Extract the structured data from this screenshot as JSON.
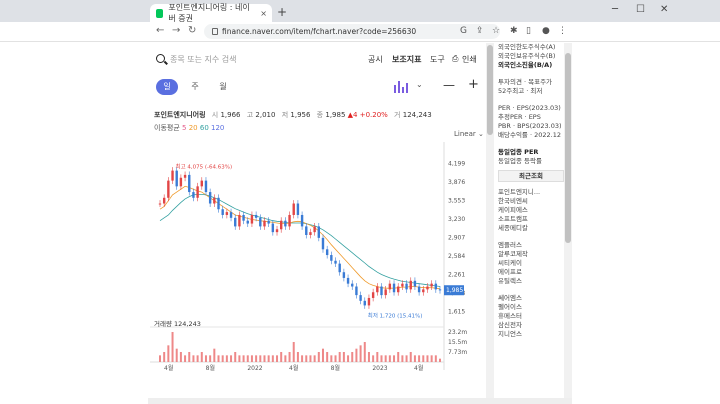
{
  "browser": {
    "tab_title": "포인트엔지니어링 : 네이버 증권",
    "tab_close": "×",
    "new_tab": "+",
    "url": "finance.naver.com/item/fchart.naver?code=256630",
    "win_min": "─",
    "win_max": "☐",
    "win_close": "✕"
  },
  "toolbar": {
    "search_placeholder": "종목 또는 지수 검색",
    "menu": [
      "공시",
      "보조지표",
      "도구",
      "인쇄"
    ]
  },
  "periods": [
    "일",
    "주",
    "월"
  ],
  "stock": {
    "name": "포인트엔지니어링",
    "open_label": "시",
    "open": "1,966",
    "high_label": "고",
    "high": "2,010",
    "low_label": "저",
    "low": "1,956",
    "close_label": "종",
    "close": "1,985",
    "change": "▲4 +0.20%",
    "volume_label": "거",
    "volume": "124,243"
  },
  "ma": {
    "label": "이동평균",
    "m5": "5",
    "m20": "20",
    "m60": "60",
    "m120": "120"
  },
  "scale_label": "Linear",
  "chart_data": {
    "type": "line",
    "x_ticks": [
      "4월",
      "8월",
      "2022",
      "4월",
      "8월",
      "2023",
      "4월"
    ],
    "y_ticks": [
      "4,199",
      "3,876",
      "3,553",
      "3,230",
      "2,907",
      "2,584",
      "2,261",
      "1,938",
      "1,615"
    ],
    "ylim": [
      1500,
      4400
    ],
    "current_price": "1,985",
    "max_label": "최고 4,075 (-64.63%)",
    "min_label": "최저 1,720 (15.41%)",
    "volume_label": "거래량 124,243",
    "volume_ticks": [
      "23.2m",
      "15.5m",
      "7.73m"
    ],
    "close": [
      3500,
      3600,
      3900,
      4075,
      3800,
      3950,
      4000,
      3700,
      3600,
      3800,
      3900,
      3700,
      3500,
      3600,
      3400,
      3300,
      3350,
      3250,
      3100,
      3300,
      3200,
      3150,
      3300,
      3250,
      3100,
      3200,
      3150,
      3000,
      3050,
      3200,
      3100,
      3300,
      3500,
      3300,
      3100,
      2950,
      3000,
      3100,
      2900,
      2700,
      2600,
      2500,
      2450,
      2300,
      2200,
      2100,
      2050,
      1900,
      1800,
      1720,
      1850,
      1950,
      2050,
      1900,
      2000,
      2100,
      1950,
      2050,
      2100,
      2000,
      2150,
      2050,
      1950,
      2000,
      2050,
      2100,
      2000,
      1985
    ],
    "ma20": [
      3400,
      3450,
      3550,
      3650,
      3700,
      3750,
      3800,
      3780,
      3750,
      3720,
      3700,
      3650,
      3600,
      3550,
      3500,
      3450,
      3400,
      3350,
      3300,
      3280,
      3260,
      3240,
      3220,
      3210,
      3200,
      3190,
      3180,
      3170,
      3160,
      3150,
      3150,
      3160,
      3180,
      3190,
      3180,
      3150,
      3120,
      3080,
      3020,
      2950,
      2870,
      2780,
      2700,
      2620,
      2540,
      2460,
      2380,
      2300,
      2220,
      2150,
      2100,
      2070,
      2050,
      2030,
      2020,
      2020,
      2020,
      2030,
      2040,
      2040,
      2050,
      2050,
      2040,
      2030,
      2030,
      2030,
      2020,
      2010
    ],
    "ma60": [
      3200,
      3250,
      3300,
      3380,
      3450,
      3520,
      3580,
      3620,
      3650,
      3660,
      3660,
      3650,
      3630,
      3600,
      3570,
      3530,
      3490,
      3450,
      3410,
      3380,
      3350,
      3320,
      3300,
      3280,
      3260,
      3240,
      3220,
      3200,
      3190,
      3180,
      3170,
      3160,
      3160,
      3160,
      3160,
      3150,
      3130,
      3110,
      3080,
      3040,
      2990,
      2940,
      2880,
      2820,
      2760,
      2700,
      2640,
      2580,
      2520,
      2460,
      2400,
      2350,
      2300,
      2260,
      2230,
      2200,
      2180,
      2160,
      2140,
      2130,
      2120,
      2110,
      2100,
      2090,
      2080,
      2070,
      2060,
      2050
    ],
    "volume": [
      2,
      3,
      5,
      9,
      4,
      3,
      2,
      3,
      2,
      2,
      3,
      2,
      2,
      4,
      2,
      2,
      2,
      2,
      3,
      2,
      2,
      2,
      2,
      2,
      2,
      2,
      2,
      2,
      2,
      3,
      2,
      3,
      6,
      3,
      2,
      2,
      2,
      2,
      3,
      4,
      3,
      2,
      2,
      3,
      3,
      2,
      3,
      4,
      5,
      6,
      3,
      2,
      3,
      2,
      2,
      2,
      2,
      3,
      2,
      2,
      3,
      2,
      2,
      2,
      2,
      2,
      2,
      1
    ]
  },
  "sidebar": {
    "items_top": [
      "외국인한도주식수(A)",
      "외국인보유주식수(B)",
      "외국인소진율(B/A)"
    ],
    "items_mid": [
      "투자의견 · 목표주가",
      "52주최고 · 최저"
    ],
    "items_per": [
      "PER · EPS(2023.03)",
      "추정PER · EPS",
      "PBR · BPS(2023.03)",
      "배당수익률 · 2022.12"
    ],
    "items_sector": [
      "동일업종 PER",
      "동일업종 등락률"
    ],
    "recent_header": "최근조회",
    "items_recent": [
      "포인트엔지니...",
      "한국비엔씨",
      "케이피에스",
      "소프트캠프",
      "세종메디칼"
    ],
    "items_recent2": [
      "엠플러스",
      "알루코제작",
      "씨티케이",
      "에이프로",
      "유틸렉스"
    ],
    "items_recent3": [
      "쎄어엠스",
      "펠어이스",
      "휴메스터",
      "삼신전자",
      "지니언스"
    ]
  }
}
